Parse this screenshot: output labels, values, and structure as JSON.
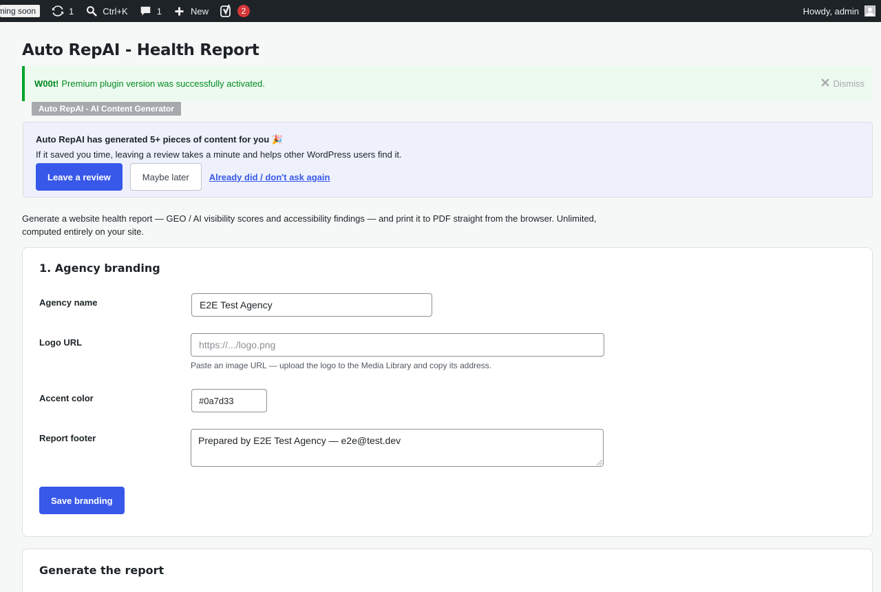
{
  "adminbar": {
    "coming_soon": "Coming soon",
    "updates_count": "1",
    "search_shortcut": "Ctrl+K",
    "comments_count": "1",
    "new_label": "New",
    "yoast_count": "2",
    "howdy": "Howdy, admin"
  },
  "page": {
    "title": "Auto RepAI - Health Report"
  },
  "notice": {
    "strong": "W00t!",
    "message": "Premium plugin version was successfully activated.",
    "dismiss": "Dismiss",
    "color": "#00a32a"
  },
  "plugin_tag": "Auto RepAI - AI Content Generator",
  "review": {
    "title": "Auto RepAI has generated 5+ pieces of content for you 🎉",
    "subtitle": "If it saved you time, leaving a review takes a minute and helps other WordPress users find it.",
    "leave_review": "Leave a review",
    "maybe_later": "Maybe later",
    "already_did": "Already did / don't ask again"
  },
  "intro": "Generate a website health report — GEO / AI visibility scores and accessibility findings — and print it to PDF straight from the browser. Unlimited, computed entirely on your site.",
  "branding": {
    "title": "1. Agency branding",
    "agency_name_label": "Agency name",
    "agency_name_value": "E2E Test Agency",
    "logo_url_label": "Logo URL",
    "logo_url_placeholder": "https://.../logo.png",
    "logo_help": "Paste an image URL — upload the logo to the Media Library and copy its address.",
    "accent_label": "Accent color",
    "accent_value": "#0a7d33",
    "footer_label": "Report footer",
    "footer_value": "Prepared by E2E Test Agency — e2e@test.dev",
    "save_button": "Save branding"
  },
  "generate": {
    "title": "Generate the report"
  },
  "colors": {
    "primary": "#3858e9",
    "adminbar": "#1d2327"
  }
}
